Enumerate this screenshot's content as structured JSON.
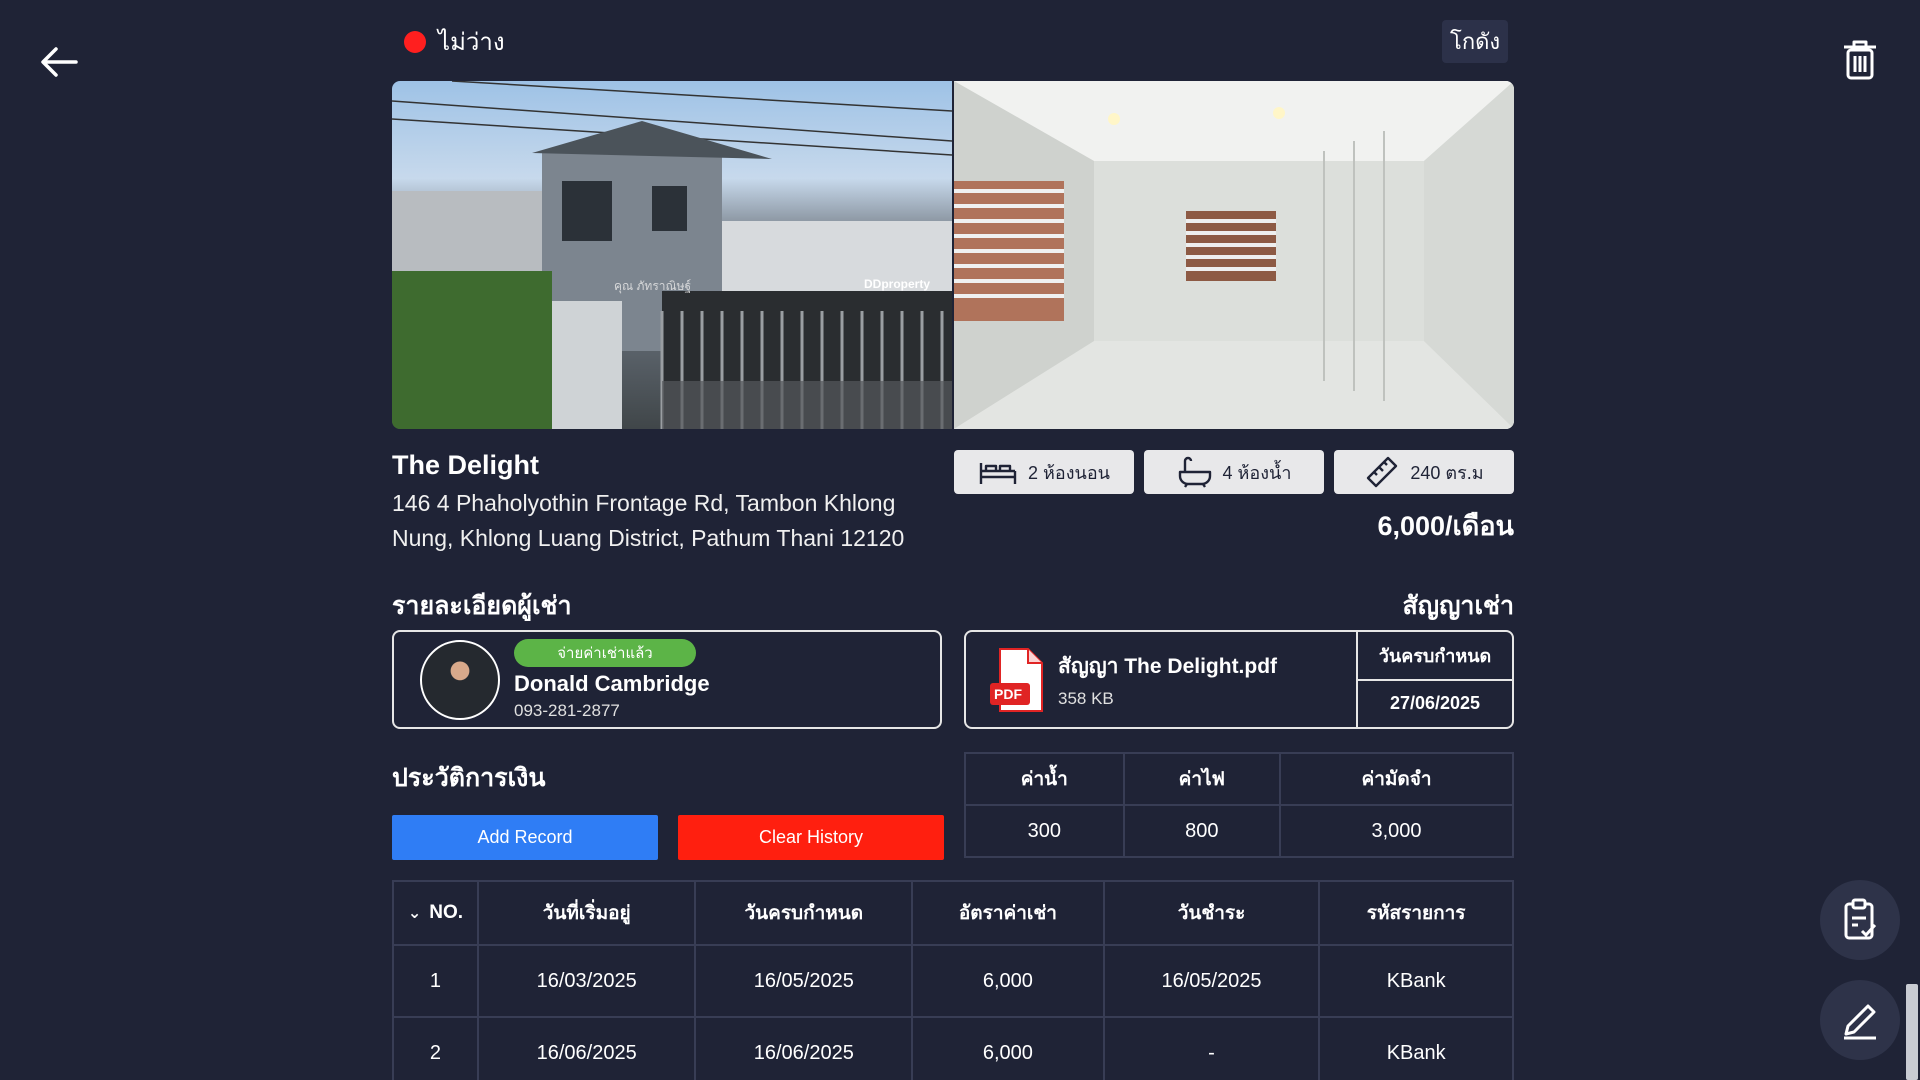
{
  "status": {
    "label": "ไม่ว่าง",
    "color": "#ff1f1f"
  },
  "category": "โกดัง",
  "property": {
    "name": "The Delight",
    "address": "146 4 Phaholyothin Frontage Rd, Tambon Khlong Nung, Khlong Luang District, Pathum Thani 12120",
    "features": [
      {
        "icon": "bed-icon",
        "label": "2 ห้องนอน"
      },
      {
        "icon": "bathtub-icon",
        "label": "4 ห้องน้ำ"
      },
      {
        "icon": "ruler-icon",
        "label": "240 ตร.ม"
      }
    ],
    "price": "6,000/เดือน",
    "photos": [
      {
        "watermark_name": "คุณ ภัทราณิษฐ์",
        "watermark_brand": "DDproperty"
      },
      {}
    ]
  },
  "tenant": {
    "section_title": "รายละเอียดผู้เช่า",
    "badge": "จ่ายค่าเช่าแล้ว",
    "name": "Donald Cambridge",
    "phone": "093-281-2877"
  },
  "contract": {
    "section_title": "สัญญาเช่า",
    "file_name": "สัญญา The Delight.pdf",
    "file_size": "358 KB",
    "pdf_label": "PDF",
    "due_label": "วันครบกำหนด",
    "due_date": "27/06/2025"
  },
  "finance": {
    "section_title": "ประวัติการเงิน",
    "add_button": "Add Record",
    "clear_button": "Clear History"
  },
  "utilities": {
    "headers": [
      "ค่าน้ำ",
      "ค่าไฟ",
      "ค่ามัดจำ"
    ],
    "values": [
      "300",
      "800",
      "3,000"
    ]
  },
  "history": {
    "headers": [
      "NO.",
      "วันที่เริ่มอยู่",
      "วันครบกำหนด",
      "อัตราค่าเช่า",
      "วันชำระ",
      "รหัสรายการ"
    ],
    "rows": [
      [
        "1",
        "16/03/2025",
        "16/05/2025",
        "6,000",
        "16/05/2025",
        "KBank"
      ],
      [
        "2",
        "16/06/2025",
        "16/06/2025",
        "6,000",
        "-",
        "KBank"
      ]
    ]
  },
  "colors": {
    "background": "#1f2336",
    "paid": "#5cb447",
    "add": "#2f7df5",
    "clear": "#ff1f0f"
  }
}
